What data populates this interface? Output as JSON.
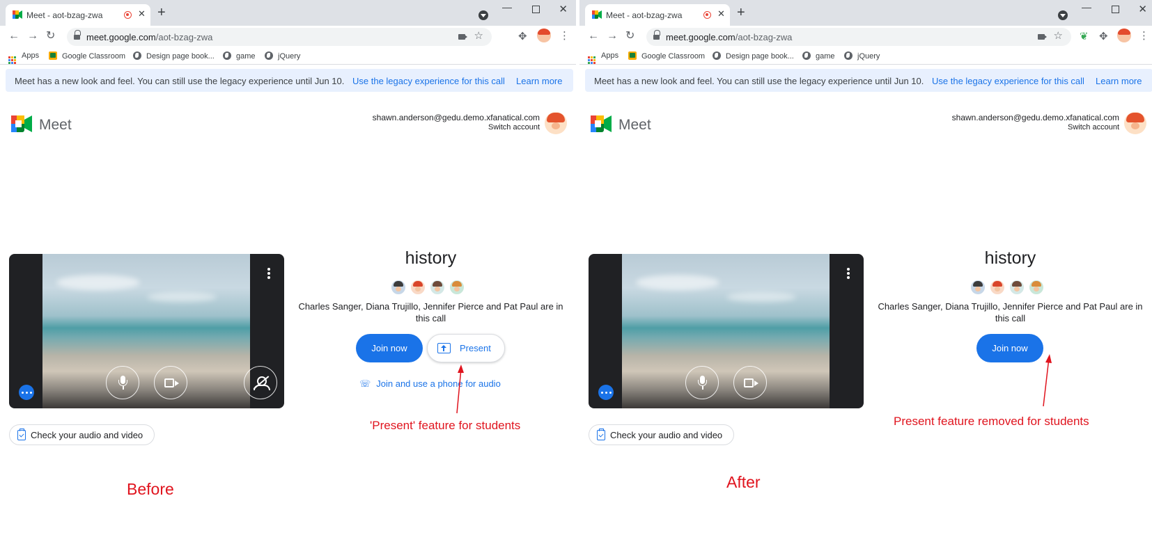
{
  "colors": {
    "accent": "#1a73e8",
    "annotation": "#e0141e",
    "banner_bg": "#e8f0fe"
  },
  "panels": [
    {
      "browser": {
        "tab_title": "Meet - aot-bzag-zwa",
        "url_host": "meet.google.com",
        "url_path": "/aot-bzag-zwa",
        "bookmarks": [
          "Apps",
          "Google Classroom",
          "Design page book...",
          "game",
          "jQuery"
        ]
      },
      "banner": {
        "text": "Meet has a new look and feel. You can still use the legacy experience until Jun 10.",
        "legacy_link": "Use the legacy experience for this call",
        "learn_more": "Learn more"
      },
      "header": {
        "app_name": "Meet",
        "account_email": "shawn.anderson@gedu.demo.xfanatical.com",
        "switch_account": "Switch account"
      },
      "preview": {
        "check_label": "Check your audio and video"
      },
      "call": {
        "title": "history",
        "participants_text": "Charles Sanger, Diana Trujillo, Jennifer Pierce and Pat Paul are in this call",
        "join_label": "Join now",
        "present_label": "Present",
        "phone_label": "Join and use a phone for audio"
      },
      "annotation": "'Present' feature for students",
      "caption": "Before"
    },
    {
      "browser": {
        "tab_title": "Meet - aot-bzag-zwa",
        "url_host": "meet.google.com",
        "url_path": "/aot-bzag-zwa",
        "bookmarks": [
          "Apps",
          "Google Classroom",
          "Design page book...",
          "game",
          "jQuery"
        ]
      },
      "banner": {
        "text": "Meet has a new look and feel. You can still use the legacy experience until Jun 10.",
        "legacy_link": "Use the legacy experience for this call",
        "learn_more": "Learn more"
      },
      "header": {
        "app_name": "Meet",
        "account_email": "shawn.anderson@gedu.demo.xfanatical.com",
        "switch_account": "Switch account"
      },
      "preview": {
        "check_label": "Check your audio and video"
      },
      "call": {
        "title": "history",
        "participants_text": "Charles Sanger, Diana Trujillo, Jennifer Pierce and Pat Paul are in this call",
        "join_label": "Join now"
      },
      "annotation": "Present feature removed for students",
      "caption": "After"
    }
  ]
}
